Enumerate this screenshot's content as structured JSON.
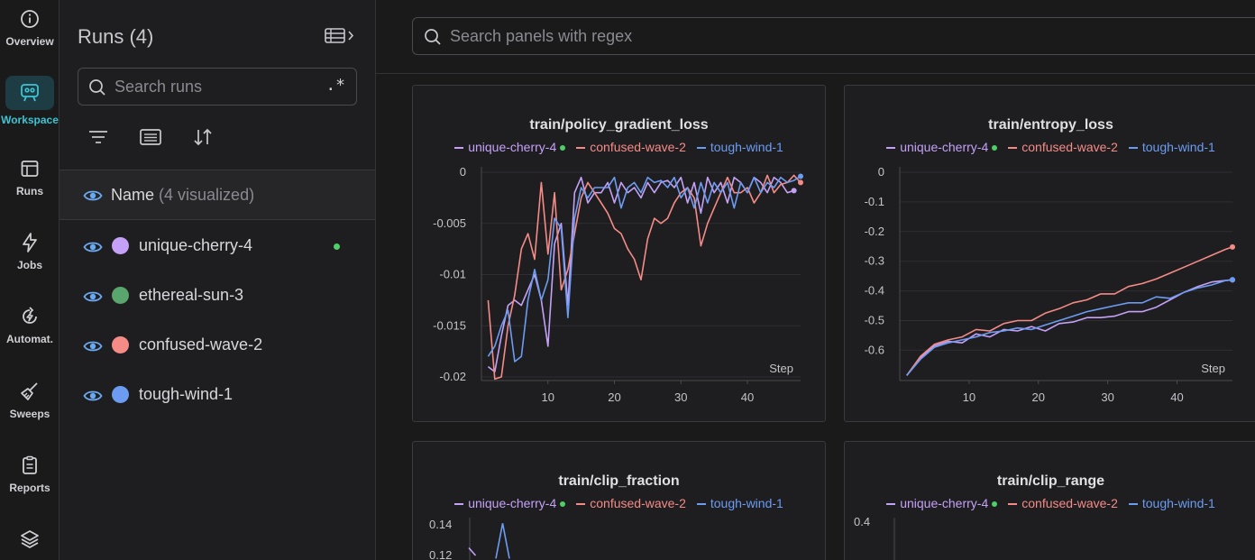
{
  "nav": [
    {
      "label": "Overview",
      "icon": "info-icon"
    },
    {
      "label": "Workspace",
      "icon": "workspace-icon",
      "active": true
    },
    {
      "label": "Runs",
      "icon": "table-icon"
    },
    {
      "label": "Jobs",
      "icon": "lightning-icon"
    },
    {
      "label": "Automat.",
      "icon": "automation-icon"
    },
    {
      "label": "Sweeps",
      "icon": "broom-icon"
    },
    {
      "label": "Reports",
      "icon": "report-icon"
    },
    {
      "label": "",
      "icon": "layers-icon"
    }
  ],
  "runs_panel": {
    "title": "Runs (4)",
    "search_placeholder": "Search runs",
    "regex_label": ".*",
    "header_name": "Name",
    "header_count": "(4 visualized)",
    "runs": [
      {
        "name": "unique-cherry-4",
        "color": "#c4a1f7",
        "live": true
      },
      {
        "name": "ethereal-sun-3",
        "color": "#5aa56d",
        "live": false
      },
      {
        "name": "confused-wave-2",
        "color": "#f58b87",
        "live": false
      },
      {
        "name": "tough-wind-1",
        "color": "#6c9cf2",
        "live": false
      }
    ]
  },
  "main": {
    "search_placeholder": "Search panels with regex",
    "legend": [
      {
        "name": "unique-cherry-4",
        "color": "#c4a1f7",
        "live": true
      },
      {
        "name": "confused-wave-2",
        "color": "#f58b87",
        "live": false
      },
      {
        "name": "tough-wind-1",
        "color": "#6c9cf2",
        "live": false
      }
    ],
    "step_label": "Step"
  },
  "chart_data": [
    {
      "type": "line",
      "title": "train/policy_gradient_loss",
      "xlabel": "Step",
      "ylabel": "",
      "xlim": [
        0,
        48
      ],
      "ylim": [
        -0.02,
        0.0
      ],
      "x_ticks": [
        10,
        20,
        30,
        40
      ],
      "y_ticks": [
        "0",
        "-0.005",
        "-0.01",
        "-0.015",
        "-0.02"
      ],
      "y_tick_values": [
        0,
        -0.005,
        -0.01,
        -0.015,
        -0.02
      ],
      "grid": true,
      "legend_position": "top",
      "series": [
        {
          "name": "unique-cherry-4",
          "color": "#c4a1f7",
          "x": [
            1,
            2,
            3,
            4,
            5,
            6,
            7,
            8,
            9,
            10,
            11,
            12,
            13,
            14,
            15,
            16,
            17,
            18,
            19,
            20,
            21,
            22,
            23,
            24,
            25,
            26,
            27,
            28,
            29,
            30,
            31,
            32,
            33,
            34,
            35,
            36,
            37,
            38,
            39,
            40,
            41,
            42,
            43,
            44,
            45,
            46,
            47
          ],
          "values": [
            -0.019,
            -0.0195,
            -0.016,
            -0.013,
            -0.0125,
            -0.013,
            -0.0115,
            -0.01,
            -0.0125,
            -0.017,
            -0.007,
            -0.005,
            -0.013,
            -0.002,
            -0.0005,
            -0.003,
            -0.002,
            -0.002,
            -0.001,
            -0.003,
            -0.001,
            -0.002,
            -0.0015,
            -0.0025,
            -0.001,
            -0.002,
            -0.001,
            -0.0008,
            -0.0015,
            -0.0005,
            -0.003,
            -0.001,
            -0.004,
            -0.0005,
            -0.002,
            -0.001,
            -0.003,
            -0.0005,
            -0.001,
            -0.002,
            -0.0005,
            -0.001,
            -0.002,
            -0.0005,
            -0.001,
            -0.002,
            -0.0018
          ]
        },
        {
          "name": "confused-wave-2",
          "color": "#f58b87",
          "x": [
            1,
            2,
            3,
            4,
            5,
            6,
            7,
            8,
            9,
            10,
            11,
            12,
            13,
            14,
            15,
            16,
            17,
            18,
            19,
            20,
            21,
            22,
            23,
            24,
            25,
            26,
            27,
            28,
            29,
            30,
            31,
            32,
            33,
            34,
            35,
            36,
            37,
            38,
            39,
            40,
            41,
            42,
            43,
            44,
            45,
            46,
            47,
            48
          ],
          "values": [
            -0.0125,
            -0.0202,
            -0.02,
            -0.015,
            -0.012,
            -0.0075,
            -0.006,
            -0.0085,
            -0.001,
            -0.008,
            -0.002,
            -0.0115,
            -0.0095,
            -0.006,
            -0.0025,
            -0.001,
            -0.002,
            -0.003,
            -0.004,
            -0.0055,
            -0.006,
            -0.0075,
            -0.0085,
            -0.0105,
            -0.0065,
            -0.0045,
            -0.005,
            -0.0045,
            -0.003,
            -0.002,
            -0.0015,
            -0.0025,
            -0.0072,
            -0.005,
            -0.0035,
            -0.002,
            -0.0005,
            -0.002,
            -0.002,
            -0.0015,
            -0.003,
            -0.002,
            -0.0003,
            -0.002,
            -0.0012,
            -0.001,
            -0.0003,
            -0.001
          ]
        },
        {
          "name": "tough-wind-1",
          "color": "#6c9cf2",
          "x": [
            1,
            2,
            3,
            4,
            5,
            6,
            7,
            8,
            9,
            10,
            11,
            12,
            13,
            14,
            15,
            16,
            17,
            18,
            19,
            20,
            21,
            22,
            23,
            24,
            25,
            26,
            27,
            28,
            29,
            30,
            31,
            32,
            33,
            34,
            35,
            36,
            37,
            38,
            39,
            40,
            41,
            42,
            43,
            44,
            45,
            46,
            47,
            48
          ],
          "values": [
            -0.018,
            -0.017,
            -0.015,
            -0.0135,
            -0.0185,
            -0.018,
            -0.0125,
            -0.0095,
            -0.0125,
            -0.0105,
            -0.0045,
            -0.0055,
            -0.0142,
            -0.0045,
            -0.0015,
            -0.0025,
            -0.0015,
            -0.0015,
            -0.0015,
            -0.0005,
            -0.0035,
            -0.0015,
            -0.001,
            -0.002,
            -0.0005,
            -0.001,
            -0.0008,
            -0.0015,
            -0.0005,
            -0.0025,
            -0.0015,
            -0.0035,
            -0.001,
            -0.003,
            -0.001,
            -0.002,
            -0.001,
            -0.0035,
            -0.001,
            -0.002,
            -0.0005,
            -0.002,
            -0.001,
            -0.0015,
            -0.0005,
            -0.001,
            -0.0008,
            -0.0004
          ]
        }
      ]
    },
    {
      "type": "line",
      "title": "train/entropy_loss",
      "xlabel": "Step",
      "ylabel": "",
      "xlim": [
        0,
        48
      ],
      "ylim": [
        -0.69,
        0.0
      ],
      "x_ticks": [
        10,
        20,
        30,
        40
      ],
      "y_ticks": [
        "0",
        "-0.1",
        "-0.2",
        "-0.3",
        "-0.4",
        "-0.5",
        "-0.6"
      ],
      "y_tick_values": [
        0,
        -0.1,
        -0.2,
        -0.3,
        -0.4,
        -0.5,
        -0.6
      ],
      "grid": true,
      "legend_position": "top",
      "series": [
        {
          "name": "unique-cherry-4",
          "color": "#c4a1f7",
          "x": [
            1,
            3,
            5,
            7,
            9,
            11,
            13,
            15,
            17,
            19,
            21,
            23,
            25,
            27,
            29,
            31,
            33,
            35,
            37,
            39,
            41,
            43,
            45,
            47,
            48
          ],
          "values": [
            -0.685,
            -0.625,
            -0.585,
            -0.57,
            -0.575,
            -0.545,
            -0.555,
            -0.53,
            -0.535,
            -0.52,
            -0.535,
            -0.51,
            -0.505,
            -0.49,
            -0.49,
            -0.485,
            -0.47,
            -0.47,
            -0.455,
            -0.43,
            -0.405,
            -0.385,
            -0.37,
            -0.365,
            -0.363
          ]
        },
        {
          "name": "confused-wave-2",
          "color": "#f58b87",
          "x": [
            1,
            3,
            5,
            7,
            9,
            11,
            13,
            15,
            17,
            19,
            21,
            23,
            25,
            27,
            29,
            31,
            33,
            35,
            37,
            39,
            41,
            43,
            45,
            47,
            48
          ],
          "values": [
            -0.685,
            -0.62,
            -0.58,
            -0.565,
            -0.555,
            -0.53,
            -0.535,
            -0.51,
            -0.5,
            -0.5,
            -0.475,
            -0.46,
            -0.44,
            -0.43,
            -0.41,
            -0.41,
            -0.385,
            -0.375,
            -0.36,
            -0.34,
            -0.32,
            -0.3,
            -0.28,
            -0.26,
            -0.252
          ]
        },
        {
          "name": "tough-wind-1",
          "color": "#6c9cf2",
          "x": [
            1,
            3,
            5,
            7,
            9,
            11,
            13,
            15,
            17,
            19,
            21,
            23,
            25,
            27,
            29,
            31,
            33,
            35,
            37,
            39,
            41,
            43,
            45,
            47,
            48
          ],
          "values": [
            -0.685,
            -0.63,
            -0.59,
            -0.575,
            -0.565,
            -0.555,
            -0.54,
            -0.535,
            -0.525,
            -0.53,
            -0.515,
            -0.5,
            -0.485,
            -0.47,
            -0.46,
            -0.45,
            -0.44,
            -0.44,
            -0.42,
            -0.425,
            -0.405,
            -0.39,
            -0.38,
            -0.365,
            -0.362
          ]
        }
      ]
    },
    {
      "type": "line",
      "title": "train/clip_fraction",
      "xlabel": "",
      "ylabel": "",
      "y_ticks": [
        "0.14",
        "0.12"
      ],
      "legend_position": "top",
      "series": [
        {
          "name": "unique-cherry-4",
          "color": "#c4a1f7",
          "x": [
            0,
            1
          ],
          "values": [
            0.125,
            0.12
          ]
        },
        {
          "name": "tough-wind-1",
          "color": "#6c9cf2",
          "x": [
            4,
            5,
            6
          ],
          "values": [
            0.118,
            0.141,
            0.118
          ]
        }
      ]
    },
    {
      "type": "line",
      "title": "train/clip_range",
      "xlabel": "",
      "ylabel": "",
      "y_ticks": [
        "0.4"
      ],
      "legend_position": "top",
      "series": []
    }
  ]
}
